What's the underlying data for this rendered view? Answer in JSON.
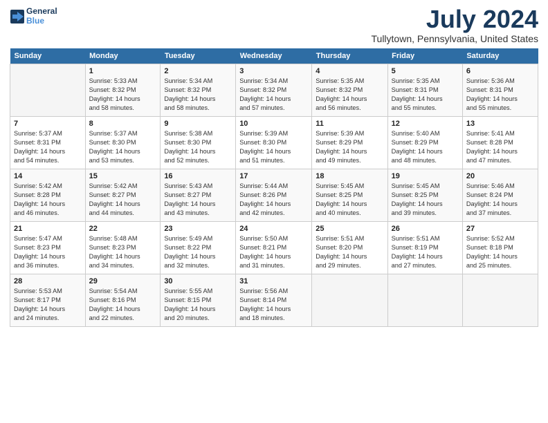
{
  "logo": {
    "line1": "General",
    "line2": "Blue"
  },
  "title": "July 2024",
  "subtitle": "Tullytown, Pennsylvania, United States",
  "headers": [
    "Sunday",
    "Monday",
    "Tuesday",
    "Wednesday",
    "Thursday",
    "Friday",
    "Saturday"
  ],
  "weeks": [
    [
      {
        "day": "",
        "info": ""
      },
      {
        "day": "1",
        "info": "Sunrise: 5:33 AM\nSunset: 8:32 PM\nDaylight: 14 hours\nand 58 minutes."
      },
      {
        "day": "2",
        "info": "Sunrise: 5:34 AM\nSunset: 8:32 PM\nDaylight: 14 hours\nand 58 minutes."
      },
      {
        "day": "3",
        "info": "Sunrise: 5:34 AM\nSunset: 8:32 PM\nDaylight: 14 hours\nand 57 minutes."
      },
      {
        "day": "4",
        "info": "Sunrise: 5:35 AM\nSunset: 8:32 PM\nDaylight: 14 hours\nand 56 minutes."
      },
      {
        "day": "5",
        "info": "Sunrise: 5:35 AM\nSunset: 8:31 PM\nDaylight: 14 hours\nand 55 minutes."
      },
      {
        "day": "6",
        "info": "Sunrise: 5:36 AM\nSunset: 8:31 PM\nDaylight: 14 hours\nand 55 minutes."
      }
    ],
    [
      {
        "day": "7",
        "info": "Sunrise: 5:37 AM\nSunset: 8:31 PM\nDaylight: 14 hours\nand 54 minutes."
      },
      {
        "day": "8",
        "info": "Sunrise: 5:37 AM\nSunset: 8:30 PM\nDaylight: 14 hours\nand 53 minutes."
      },
      {
        "day": "9",
        "info": "Sunrise: 5:38 AM\nSunset: 8:30 PM\nDaylight: 14 hours\nand 52 minutes."
      },
      {
        "day": "10",
        "info": "Sunrise: 5:39 AM\nSunset: 8:30 PM\nDaylight: 14 hours\nand 51 minutes."
      },
      {
        "day": "11",
        "info": "Sunrise: 5:39 AM\nSunset: 8:29 PM\nDaylight: 14 hours\nand 49 minutes."
      },
      {
        "day": "12",
        "info": "Sunrise: 5:40 AM\nSunset: 8:29 PM\nDaylight: 14 hours\nand 48 minutes."
      },
      {
        "day": "13",
        "info": "Sunrise: 5:41 AM\nSunset: 8:28 PM\nDaylight: 14 hours\nand 47 minutes."
      }
    ],
    [
      {
        "day": "14",
        "info": "Sunrise: 5:42 AM\nSunset: 8:28 PM\nDaylight: 14 hours\nand 46 minutes."
      },
      {
        "day": "15",
        "info": "Sunrise: 5:42 AM\nSunset: 8:27 PM\nDaylight: 14 hours\nand 44 minutes."
      },
      {
        "day": "16",
        "info": "Sunrise: 5:43 AM\nSunset: 8:27 PM\nDaylight: 14 hours\nand 43 minutes."
      },
      {
        "day": "17",
        "info": "Sunrise: 5:44 AM\nSunset: 8:26 PM\nDaylight: 14 hours\nand 42 minutes."
      },
      {
        "day": "18",
        "info": "Sunrise: 5:45 AM\nSunset: 8:25 PM\nDaylight: 14 hours\nand 40 minutes."
      },
      {
        "day": "19",
        "info": "Sunrise: 5:45 AM\nSunset: 8:25 PM\nDaylight: 14 hours\nand 39 minutes."
      },
      {
        "day": "20",
        "info": "Sunrise: 5:46 AM\nSunset: 8:24 PM\nDaylight: 14 hours\nand 37 minutes."
      }
    ],
    [
      {
        "day": "21",
        "info": "Sunrise: 5:47 AM\nSunset: 8:23 PM\nDaylight: 14 hours\nand 36 minutes."
      },
      {
        "day": "22",
        "info": "Sunrise: 5:48 AM\nSunset: 8:23 PM\nDaylight: 14 hours\nand 34 minutes."
      },
      {
        "day": "23",
        "info": "Sunrise: 5:49 AM\nSunset: 8:22 PM\nDaylight: 14 hours\nand 32 minutes."
      },
      {
        "day": "24",
        "info": "Sunrise: 5:50 AM\nSunset: 8:21 PM\nDaylight: 14 hours\nand 31 minutes."
      },
      {
        "day": "25",
        "info": "Sunrise: 5:51 AM\nSunset: 8:20 PM\nDaylight: 14 hours\nand 29 minutes."
      },
      {
        "day": "26",
        "info": "Sunrise: 5:51 AM\nSunset: 8:19 PM\nDaylight: 14 hours\nand 27 minutes."
      },
      {
        "day": "27",
        "info": "Sunrise: 5:52 AM\nSunset: 8:18 PM\nDaylight: 14 hours\nand 25 minutes."
      }
    ],
    [
      {
        "day": "28",
        "info": "Sunrise: 5:53 AM\nSunset: 8:17 PM\nDaylight: 14 hours\nand 24 minutes."
      },
      {
        "day": "29",
        "info": "Sunrise: 5:54 AM\nSunset: 8:16 PM\nDaylight: 14 hours\nand 22 minutes."
      },
      {
        "day": "30",
        "info": "Sunrise: 5:55 AM\nSunset: 8:15 PM\nDaylight: 14 hours\nand 20 minutes."
      },
      {
        "day": "31",
        "info": "Sunrise: 5:56 AM\nSunset: 8:14 PM\nDaylight: 14 hours\nand 18 minutes."
      },
      {
        "day": "",
        "info": ""
      },
      {
        "day": "",
        "info": ""
      },
      {
        "day": "",
        "info": ""
      }
    ]
  ]
}
